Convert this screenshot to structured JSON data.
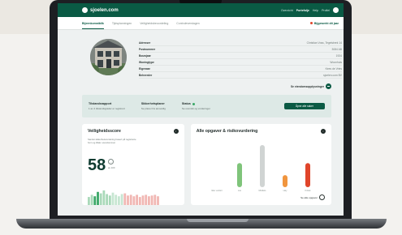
{
  "app": {
    "logo_text": "sjoelen.com",
    "top_links": [
      "Overzicht",
      "Portefolje",
      "Help",
      "Profiel"
    ],
    "active_top_link": "Portefolje"
  },
  "tabs": {
    "items": [
      "Bijeenkomstblik",
      "Tijdsplanningen",
      "Veiligheidsbeoordeling",
      "Controleverslagen"
    ],
    "active": 0,
    "right_label": "Bijgewerkt dit jaar"
  },
  "profile": {
    "rows": [
      {
        "label": "Adresser",
        "value": "Christian Voss, Tegelsbrek 14"
      },
      {
        "label": "Postnummer",
        "value": "3084 AB"
      },
      {
        "label": "Bouwjaar",
        "value": "1924"
      },
      {
        "label": "Woningtype",
        "value": "Woonhuis"
      },
      {
        "label": "Eigenaar",
        "value": "Kees de Vries"
      },
      {
        "label": "Beheerder",
        "value": "sjoelen.com BV"
      }
    ],
    "more_label": "Se eiendomsopplysninger"
  },
  "status": {
    "items": [
      {
        "title": "Tilstandsrapport",
        "sub": "1 av 4 tilstandsgrader er registrert"
      },
      {
        "title": "Sikkerhetsplaner",
        "sub": "Se planer fra ansvarlig"
      },
      {
        "title": "Status",
        "sub": "Se oversikt og vurderinger"
      }
    ],
    "button_label": "Åpne alle saker"
  },
  "safety_card": {
    "title": "Veiligheidsscore",
    "description": "Samlet sikkerhetsvurdering basert på registrerte funn og tiltak i eiendommen",
    "score": "58",
    "score_label": "av 100",
    "histogram": [
      0.55,
      0.7,
      0.6,
      0.9,
      0.8,
      1.0,
      0.75,
      0.65,
      0.85,
      0.7,
      0.6,
      0.75,
      0.8,
      0.65,
      0.7,
      0.6,
      0.7,
      0.55,
      0.65,
      0.7,
      0.6,
      0.65,
      0.7,
      0.6
    ]
  },
  "risk_card": {
    "title": "Alle opgaver & risikovurdering",
    "link_label": "Se alle opgaver",
    "columns": [
      {
        "label": "Ikke vurdert",
        "value": 0,
        "color": "#d8e0de"
      },
      {
        "label": "Lav",
        "value": 4,
        "color": "#7fc47a"
      },
      {
        "label": "Middels",
        "value": 7,
        "color": "#d0d4d3"
      },
      {
        "label": "Høy",
        "value": 2,
        "color": "#f0953e"
      },
      {
        "label": "Kritisk",
        "value": 4,
        "color": "#e0452b"
      }
    ]
  }
}
